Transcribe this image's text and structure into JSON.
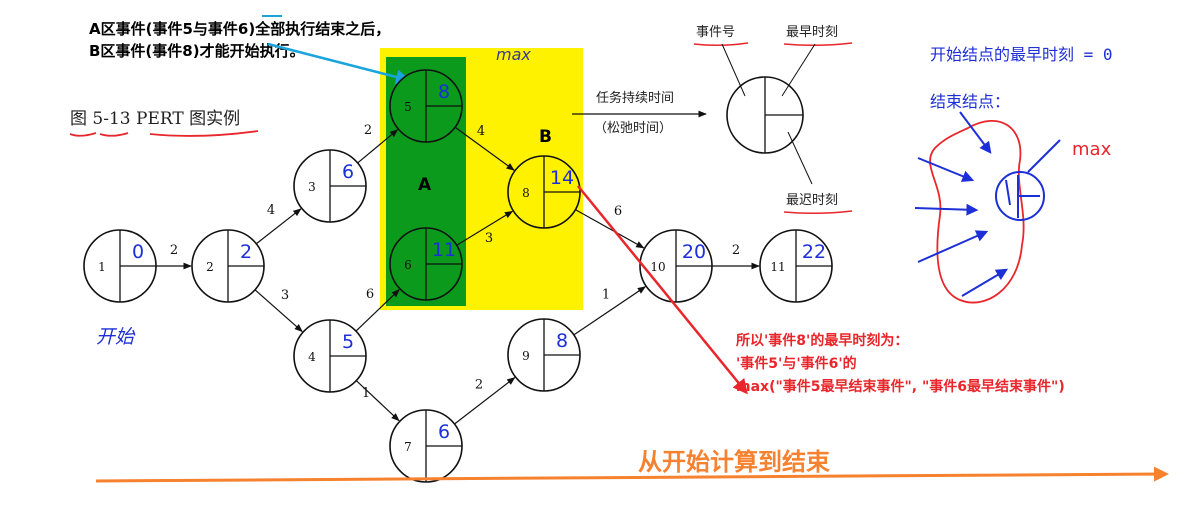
{
  "note_top": {
    "line1": "A区事件(事件5与事件6)全部执行结束之后，",
    "line2": "B区事件(事件8)才能开始执行。"
  },
  "figure_caption": "图 5-13   PERT 图实例",
  "region_labels": {
    "a": "A",
    "b": "B",
    "max": "max"
  },
  "nodes": [
    {
      "id": "1",
      "earliest": "0"
    },
    {
      "id": "2",
      "earliest": "2"
    },
    {
      "id": "3",
      "earliest": "6"
    },
    {
      "id": "4",
      "earliest": "5"
    },
    {
      "id": "5",
      "earliest": "8"
    },
    {
      "id": "6",
      "earliest": "11"
    },
    {
      "id": "7",
      "earliest": "6"
    },
    {
      "id": "8",
      "earliest": "14"
    },
    {
      "id": "9",
      "earliest": "8"
    },
    {
      "id": "10",
      "earliest": "20"
    },
    {
      "id": "11",
      "earliest": "22"
    }
  ],
  "edges": [
    {
      "from": "1",
      "to": "2",
      "duration": "2"
    },
    {
      "from": "2",
      "to": "3",
      "duration": "4"
    },
    {
      "from": "2",
      "to": "4",
      "duration": "3"
    },
    {
      "from": "3",
      "to": "5",
      "duration": "2"
    },
    {
      "from": "4",
      "to": "6",
      "duration": "6"
    },
    {
      "from": "4",
      "to": "7",
      "duration": "1"
    },
    {
      "from": "5",
      "to": "8",
      "duration": "4"
    },
    {
      "from": "6",
      "to": "8",
      "duration": "3"
    },
    {
      "from": "8",
      "to": "10",
      "duration": "6"
    },
    {
      "from": "7",
      "to": "9",
      "duration": "2"
    },
    {
      "from": "9",
      "to": "10",
      "duration": "1"
    },
    {
      "from": "10",
      "to": "11",
      "duration": "2"
    }
  ],
  "legend": {
    "event_no": "事件号",
    "earliest": "最早时刻",
    "task_duration": "任务持续时间",
    "slack": "（松弛时间）",
    "latest": "最迟时刻"
  },
  "right_notes": {
    "start_rule": "开始结点的最早时刻 = 0",
    "end_node": "结束结点：",
    "max": "max"
  },
  "start_label": "开始",
  "red_explanation": {
    "line1": "所以'事件8'的最早时刻为：",
    "line2": "'事件5'与'事件6'的",
    "line3": "max(\"事件5最早结束事件\", \"事件6最早结束事件\")"
  },
  "bottom_label": "从开始计算到结束",
  "colors": {
    "green": "#0b9a1c",
    "yellow": "#fff200",
    "handwriting_blue": "#1d2fd6",
    "red": "#e8262b",
    "orange": "#f6812e",
    "cyan_arrow": "#1aa3dc"
  }
}
